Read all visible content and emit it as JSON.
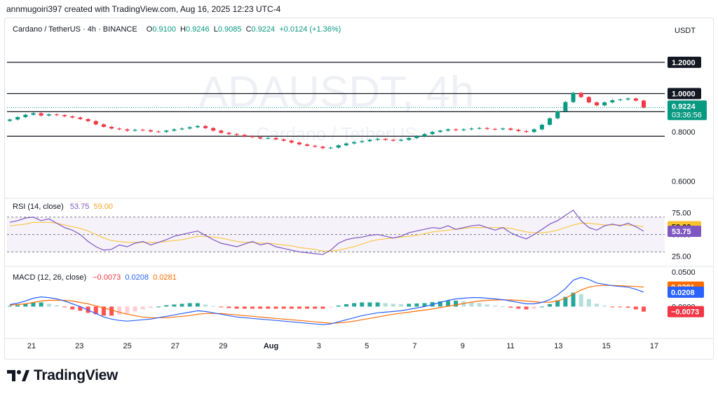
{
  "credit": "annmugoiri397 created with TradingView.com, Aug 16, 2025 12:23 UTC-4",
  "currency_button": "USDT",
  "brand_name": "TradingView",
  "watermark": {
    "symbol": "ADAUSDT, 4h",
    "name": "Cardano / TetherUS"
  },
  "price_legend": {
    "title": "Cardano / TetherUS · 4h · BINANCE",
    "o_label": "O",
    "o": "0.9100",
    "h_label": "H",
    "h": "0.9246",
    "l_label": "L",
    "l": "0.9085",
    "c_label": "C",
    "c": "0.9224",
    "change": "+0.0124 (+1.36%)"
  },
  "rsi_legend": {
    "title": "RSI (14, close)",
    "rsi": "53.75",
    "ma": "59.00"
  },
  "macd_legend": {
    "title": "MACD (12, 26, close)",
    "hist": "−0.0073",
    "macd": "0.0208",
    "signal": "0.0281"
  },
  "colors": {
    "up": "#089981",
    "down": "#f23645",
    "rsi": "#7e57c2",
    "rsi_ma": "#fbc02d",
    "macd": "#2962ff",
    "signal": "#ff6d00",
    "hist_up_strong": "#26a69a",
    "hist_up_weak": "#b2dfdb",
    "hist_down_strong": "#ff5252",
    "hist_down_weak": "#ffcdd2",
    "price_tag": "#089981"
  },
  "chart_data": [
    {
      "type": "candlestick",
      "title": "Cardano / TetherUS · 4h · BINANCE",
      "x_ticks": [
        "21",
        "23",
        "25",
        "27",
        "29",
        "Aug",
        "3",
        "5",
        "7",
        "9",
        "11",
        "13",
        "15",
        "17"
      ],
      "y_ticks": [
        "1.2000",
        "1.0000",
        "0.9000",
        "0.8000",
        "0.6000"
      ],
      "y_scale": "log",
      "ylim": [
        0.55,
        1.35
      ],
      "horizontal_lines": [
        1.2,
        1.0,
        0.9,
        0.78
      ],
      "last_price": "0.9224",
      "countdown": "03:36:56",
      "series": [
        {
          "name": "ADAUSDT",
          "close": [
            0.86,
            0.872,
            0.884,
            0.892,
            0.88,
            0.886,
            0.882,
            0.876,
            0.87,
            0.862,
            0.852,
            0.836,
            0.824,
            0.816,
            0.812,
            0.806,
            0.81,
            0.808,
            0.802,
            0.8,
            0.806,
            0.812,
            0.816,
            0.822,
            0.828,
            0.818,
            0.806,
            0.796,
            0.79,
            0.786,
            0.78,
            0.776,
            0.77,
            0.772,
            0.766,
            0.76,
            0.752,
            0.744,
            0.738,
            0.734,
            0.728,
            0.73,
            0.74,
            0.748,
            0.754,
            0.758,
            0.764,
            0.768,
            0.764,
            0.76,
            0.764,
            0.772,
            0.78,
            0.79,
            0.8,
            0.806,
            0.812,
            0.808,
            0.812,
            0.816,
            0.818,
            0.814,
            0.812,
            0.816,
            0.81,
            0.804,
            0.8,
            0.812,
            0.834,
            0.866,
            0.902,
            0.952,
            1.004,
            0.98,
            0.95,
            0.934,
            0.95,
            0.962,
            0.966,
            0.972,
            0.96,
            0.922
          ]
        }
      ]
    },
    {
      "type": "line",
      "title": "RSI (14, close)",
      "y_ticks": [
        "75.00",
        "50.00",
        "25.00"
      ],
      "ylim": [
        15,
        90
      ],
      "band": [
        30,
        70
      ],
      "series": [
        {
          "name": "RSI",
          "values": [
            64,
            66,
            69,
            70,
            66,
            68,
            63,
            58,
            55,
            50,
            42,
            36,
            32,
            33,
            38,
            36,
            40,
            42,
            38,
            41,
            44,
            48,
            50,
            52,
            54,
            49,
            44,
            40,
            38,
            36,
            39,
            42,
            38,
            40,
            36,
            34,
            32,
            30,
            29,
            28,
            27,
            32,
            40,
            44,
            46,
            47,
            49,
            50,
            48,
            46,
            48,
            52,
            54,
            56,
            58,
            57,
            60,
            56,
            58,
            60,
            61,
            58,
            55,
            58,
            52,
            48,
            45,
            50,
            56,
            62,
            66,
            72,
            78,
            66,
            58,
            55,
            60,
            62,
            60,
            63,
            59,
            53.75
          ]
        },
        {
          "name": "MA",
          "values": [
            60,
            61,
            62,
            64,
            64,
            64,
            63,
            61,
            59,
            57,
            54,
            50,
            46,
            43,
            42,
            41,
            41,
            41,
            41,
            41,
            42,
            43,
            44,
            46,
            48,
            48,
            47,
            46,
            44,
            42,
            41,
            41,
            40,
            40,
            39,
            38,
            37,
            35,
            34,
            33,
            31,
            31,
            32,
            34,
            36,
            39,
            42,
            44,
            45,
            46,
            47,
            48,
            49,
            51,
            53,
            54,
            55,
            56,
            57,
            58,
            58,
            58,
            58,
            58,
            57,
            55,
            53,
            52,
            52,
            53,
            55,
            58,
            61,
            63,
            63,
            62,
            61,
            61,
            61,
            61,
            60,
            59.0
          ]
        }
      ]
    },
    {
      "type": "bar+line",
      "title": "MACD (12, 26, close)",
      "y_ticks": [
        "0.0500",
        "0.0000"
      ],
      "ylim": [
        -0.045,
        0.06
      ],
      "series": [
        {
          "name": "MACD",
          "values": [
            0.003,
            0.005,
            0.008,
            0.012,
            0.014,
            0.013,
            0.011,
            0.008,
            0.004,
            0.0,
            -0.005,
            -0.01,
            -0.015,
            -0.018,
            -0.02,
            -0.021,
            -0.02,
            -0.019,
            -0.018,
            -0.016,
            -0.014,
            -0.012,
            -0.01,
            -0.008,
            -0.006,
            -0.007,
            -0.009,
            -0.011,
            -0.013,
            -0.015,
            -0.016,
            -0.017,
            -0.018,
            -0.019,
            -0.02,
            -0.021,
            -0.022,
            -0.023,
            -0.024,
            -0.025,
            -0.026,
            -0.025,
            -0.022,
            -0.019,
            -0.016,
            -0.013,
            -0.011,
            -0.009,
            -0.008,
            -0.007,
            -0.006,
            -0.004,
            -0.002,
            0.0,
            0.003,
            0.006,
            0.009,
            0.011,
            0.012,
            0.013,
            0.013,
            0.012,
            0.011,
            0.01,
            0.008,
            0.006,
            0.004,
            0.004,
            0.006,
            0.01,
            0.017,
            0.026,
            0.038,
            0.042,
            0.039,
            0.034,
            0.032,
            0.03,
            0.029,
            0.028,
            0.025,
            0.0208
          ]
        },
        {
          "name": "Signal",
          "values": [
            0.002,
            0.003,
            0.004,
            0.006,
            0.008,
            0.009,
            0.009,
            0.009,
            0.008,
            0.006,
            0.004,
            0.001,
            -0.002,
            -0.005,
            -0.008,
            -0.011,
            -0.013,
            -0.015,
            -0.016,
            -0.016,
            -0.016,
            -0.015,
            -0.014,
            -0.013,
            -0.011,
            -0.01,
            -0.01,
            -0.01,
            -0.011,
            -0.012,
            -0.013,
            -0.014,
            -0.015,
            -0.016,
            -0.017,
            -0.018,
            -0.019,
            -0.02,
            -0.021,
            -0.022,
            -0.023,
            -0.024,
            -0.0235,
            -0.0225,
            -0.021,
            -0.019,
            -0.017,
            -0.015,
            -0.013,
            -0.011,
            -0.0095,
            -0.008,
            -0.0065,
            -0.005,
            -0.0035,
            -0.0015,
            0.0005,
            0.0025,
            0.0045,
            0.0065,
            0.008,
            0.009,
            0.0095,
            0.0097,
            0.0095,
            0.009,
            0.008,
            0.007,
            0.0062,
            0.0064,
            0.008,
            0.012,
            0.018,
            0.024,
            0.028,
            0.03,
            0.0305,
            0.0305,
            0.03,
            0.0295,
            0.029,
            0.0281
          ]
        },
        {
          "name": "Histogram",
          "values": [
            0.001,
            0.002,
            0.004,
            0.006,
            0.006,
            0.004,
            0.002,
            -0.001,
            -0.004,
            -0.006,
            -0.009,
            -0.011,
            -0.013,
            -0.013,
            -0.012,
            -0.01,
            -0.007,
            -0.004,
            -0.002,
            0.0,
            0.002,
            0.003,
            0.004,
            0.005,
            0.005,
            0.003,
            0.001,
            -0.001,
            -0.002,
            -0.003,
            -0.003,
            -0.003,
            -0.003,
            -0.003,
            -0.003,
            -0.003,
            -0.003,
            -0.003,
            -0.003,
            -0.003,
            -0.003,
            -0.001,
            0.0015,
            0.0035,
            0.005,
            0.006,
            0.006,
            0.006,
            0.005,
            0.004,
            0.0035,
            0.004,
            0.0045,
            0.005,
            0.0065,
            0.0075,
            0.0085,
            0.0085,
            0.0075,
            0.0065,
            0.005,
            0.003,
            0.0015,
            0.0003,
            -0.0015,
            -0.003,
            -0.004,
            -0.003,
            0.0,
            0.0036,
            0.009,
            0.014,
            0.02,
            0.018,
            0.011,
            0.004,
            0.0015,
            -0.0005,
            -0.001,
            -0.0015,
            -0.004,
            -0.0073
          ]
        }
      ]
    }
  ]
}
